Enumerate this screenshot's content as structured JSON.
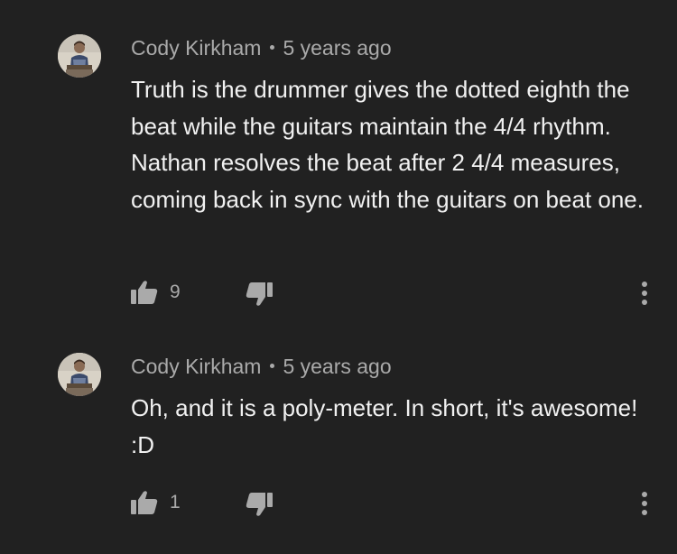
{
  "colors": {
    "background": "#212121",
    "text_primary": "#f1f1f1",
    "text_secondary": "#aaaaaa"
  },
  "comments": [
    {
      "author": "Cody Kirkham",
      "timestamp": "5 years ago",
      "text": "Truth is the drummer gives the dotted eighth the beat while the guitars maintain the 4/4 rhythm. Nathan resolves the beat after 2 4/4 measures, coming back in sync with the guitars on beat one.",
      "likes": "9",
      "icons": {
        "like": "thumbs-up-icon",
        "dislike": "thumbs-down-icon",
        "more": "more-vert-icon"
      }
    },
    {
      "author": "Cody Kirkham",
      "timestamp": "5 years ago",
      "text": "Oh, and it is a poly-meter. In short, it's awesome! :D",
      "likes": "1",
      "icons": {
        "like": "thumbs-up-icon",
        "dislike": "thumbs-down-icon",
        "more": "more-vert-icon"
      }
    }
  ]
}
